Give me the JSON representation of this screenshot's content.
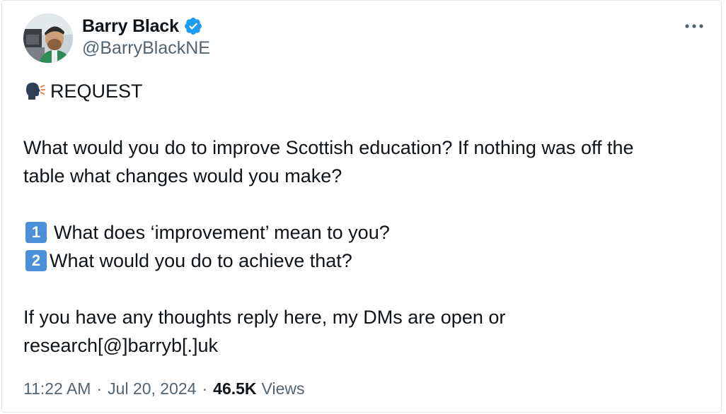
{
  "author": {
    "display_name": "Barry Black",
    "handle": "@BarryBlackNE",
    "verified_icon": "verified-badge-icon"
  },
  "menu": {
    "more_icon": "more-horizontal-icon"
  },
  "tweet": {
    "header_emoji": "speaking-head-icon",
    "header_text": "REQUEST",
    "question_line_1": "What would you do to improve Scottish education? If nothing was off the",
    "question_line_2": "table what changes would you make?",
    "item_1_number": "1",
    "item_1_text": "What does ‘improvement’ mean to you?",
    "item_2_number": "2",
    "item_2_text": "What would you do to achieve that?",
    "closing_line_1": "If you have any thoughts reply here, my DMs are open or",
    "closing_line_2": "research[@]barryb[.]uk"
  },
  "meta": {
    "time": "11:22 AM",
    "separator": "·",
    "date": "Jul 20, 2024",
    "views_count": "46.5K",
    "views_label": "Views"
  },
  "colors": {
    "verified": "#1d9bf0",
    "secondary_text": "#536471",
    "primary_text": "#0f1419",
    "keycap": "#4a8fd8"
  }
}
